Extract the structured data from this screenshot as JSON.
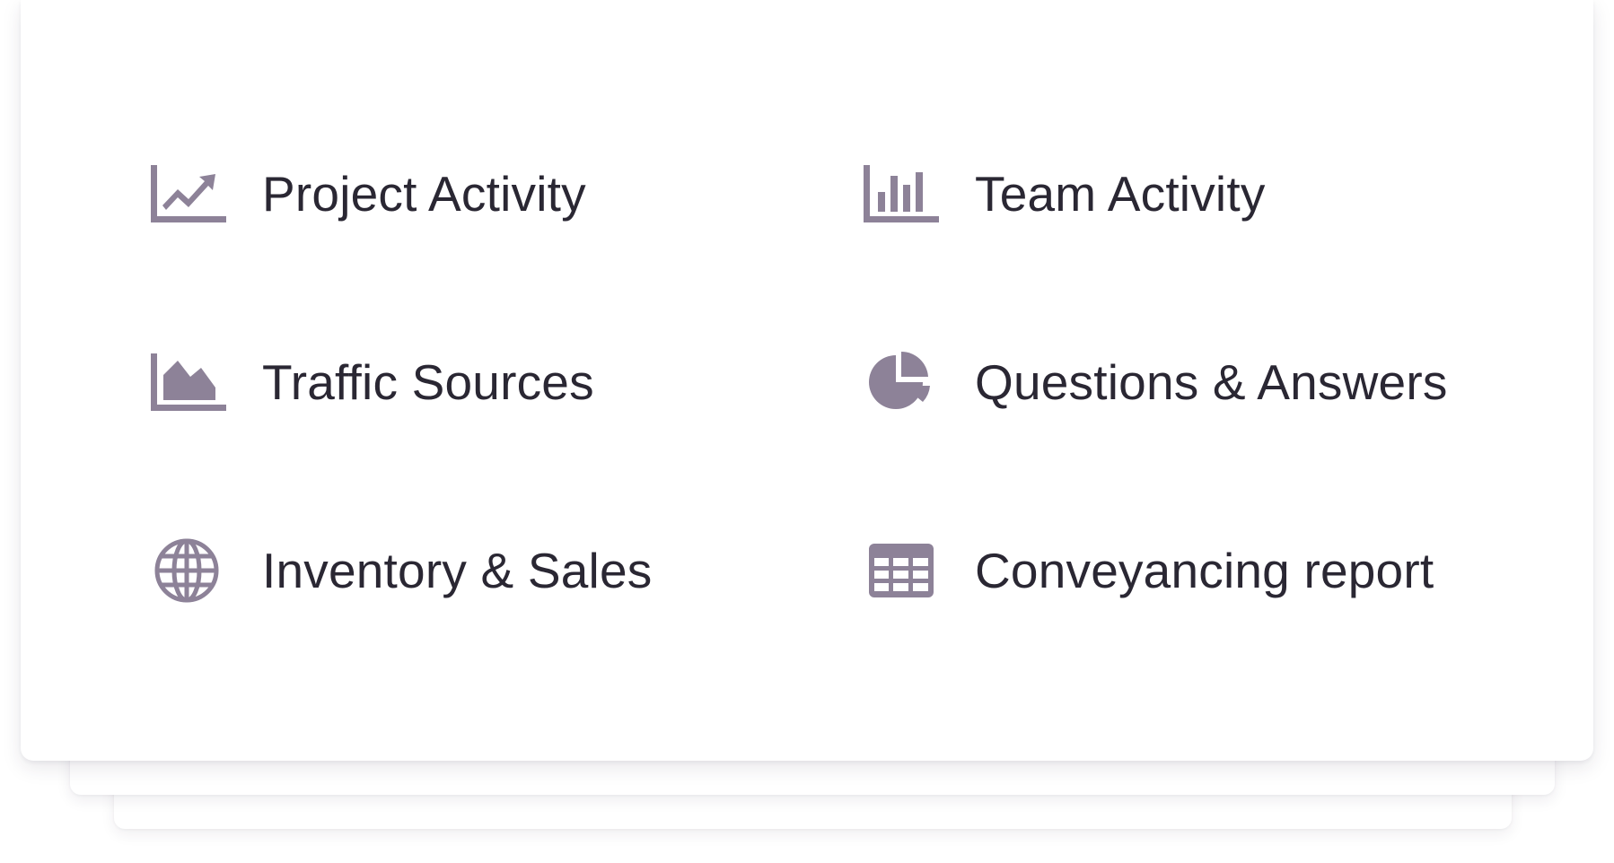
{
  "colors": {
    "icon": "#8d8298",
    "text": "#2a2733",
    "card": "#ffffff"
  },
  "reports": [
    {
      "label": "Project Activity",
      "icon": "line-chart-icon"
    },
    {
      "label": "Team Activity",
      "icon": "bar-chart-icon"
    },
    {
      "label": "Traffic Sources",
      "icon": "area-chart-icon"
    },
    {
      "label": "Questions & Answers",
      "icon": "pie-chart-icon"
    },
    {
      "label": "Inventory & Sales",
      "icon": "globe-icon"
    },
    {
      "label": "Conveyancing report",
      "icon": "table-icon"
    }
  ]
}
